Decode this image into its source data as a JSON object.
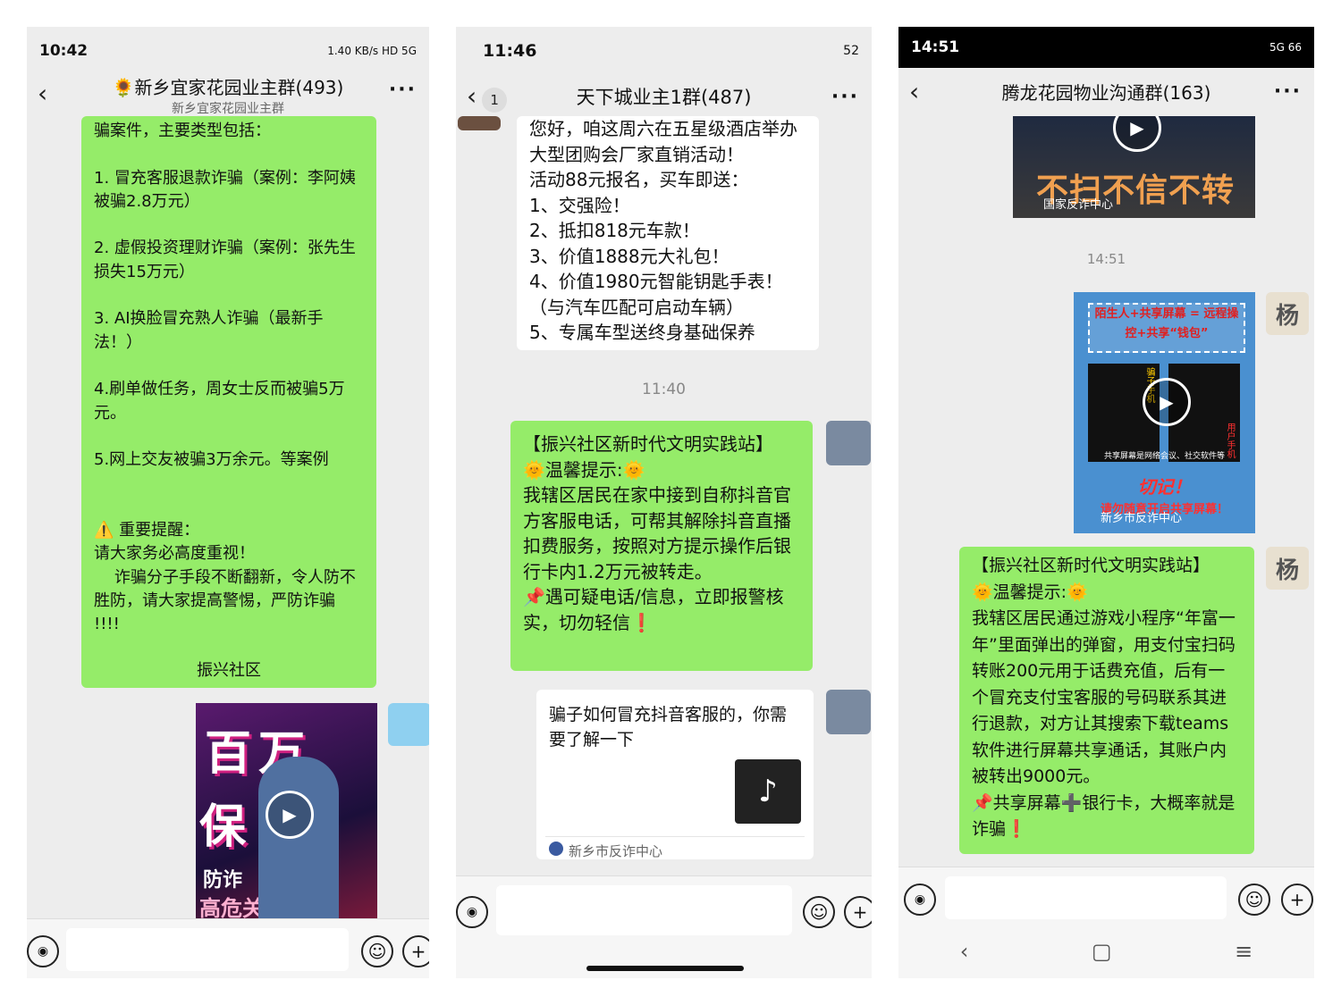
{
  "phone1": {
    "status_time": "10:42",
    "status_right": "1.40 KB/s HD 5G",
    "title": "🌻新乡宜家花园业主群(493)",
    "subtitle": "新乡宜家花园业主群",
    "bubble": "骗案件，主要类型包括：\n\n1. 冒充客服退款诈骗（案例：李阿姨被骗2.8万元）\n\n2. 虚假投资理财诈骗（案例：张先生损失15万元）\n\n3. AI换脸冒充熟人诈骗（最新手法！）\n\n4.刷单做任务，周女士反而被骗5万元。\n\n5.网上交友被骗3万余元。等案例\n\n\n⚠️ 重要提醒：\n请大家务必高度重视！\n    诈骗分子手段不断翻新，令人防不胜防，请大家提高警惕，严防诈骗 !!!!",
    "signature": "振兴社区",
    "video_text1": "百万",
    "video_text2": "保障",
    "video_text3": "防诈",
    "video_text4": "高危关键词"
  },
  "phone2": {
    "status_time": "11:46",
    "status_right": "52",
    "badge": "1",
    "title": "天下城业主1群(487)",
    "bubble1": "您好，咱这周六在五星级酒店举办大型团购会厂家直销活动！\n活动88元报名，买车即送：\n1、交强险！\n2、抵扣818元车款！\n3、价值1888元大礼包！\n4、价值1980元智能钥匙手表！（与汽车匹配可启动车辆）\n5、专属车型送终身基础保养",
    "timestamp": "11:40",
    "bubble2": "【振兴社区新时代文明实践站】\n🌞温馨提示:🌞\n我辖区居民在家中接到自称抖音官方客服电话，可帮其解除抖音直播扣费服务，按照对方提示操作后银行卡内1.2万元被转走。\n📌遇可疑电话/信息，立即报警核实，切勿轻信❗",
    "card_title": "骗子如何冒充抖音客服的，你需要了解一下",
    "card_source": "新乡市反诈中心"
  },
  "phone3": {
    "status_time": "14:51",
    "status_right": "5G 66",
    "title": "腾龙花园物业沟通群(163)",
    "video1_text": "不扫不信不转账",
    "video1_source": "国家反诈中心",
    "timestamp": "14:51",
    "video2_top": "陌生人+共享屏幕 = 远程操控+共享“钱包”",
    "video2_left": "骗子手机",
    "video2_right": "用户手机",
    "video2_caption": "共享屏幕是网络会议、社交软件等",
    "video2_bottom": "切记！",
    "video2_bottom2": "请勿随意开启共享屏幕！",
    "video2_source": "新乡市反诈中心",
    "avatar_char": "杨",
    "bubble": "【振兴社区新时代文明实践站】\n🌞温馨提示:🌞\n我辖区居民通过游戏小程序“年富一年”里面弹出的弹窗，用支付宝扫码转账200元用于话费充值，后有一个冒充支付宝客服的号码联系其进行退款，对方让其搜索下载teams软件进行屏幕共享通话，其账户内被转出9000元。\n📌共享屏幕➕银行卡，大概率就是诈骗❗"
  },
  "icons": {
    "back": "chevron-left-icon",
    "more": "more-icon",
    "voice": "voice-icon",
    "emoji": "emoji-icon",
    "plus": "plus-icon",
    "play": "play-icon",
    "mute": "mute-icon"
  },
  "colors": {
    "green_bubble": "#95ec69",
    "chat_bg": "#ededed"
  }
}
